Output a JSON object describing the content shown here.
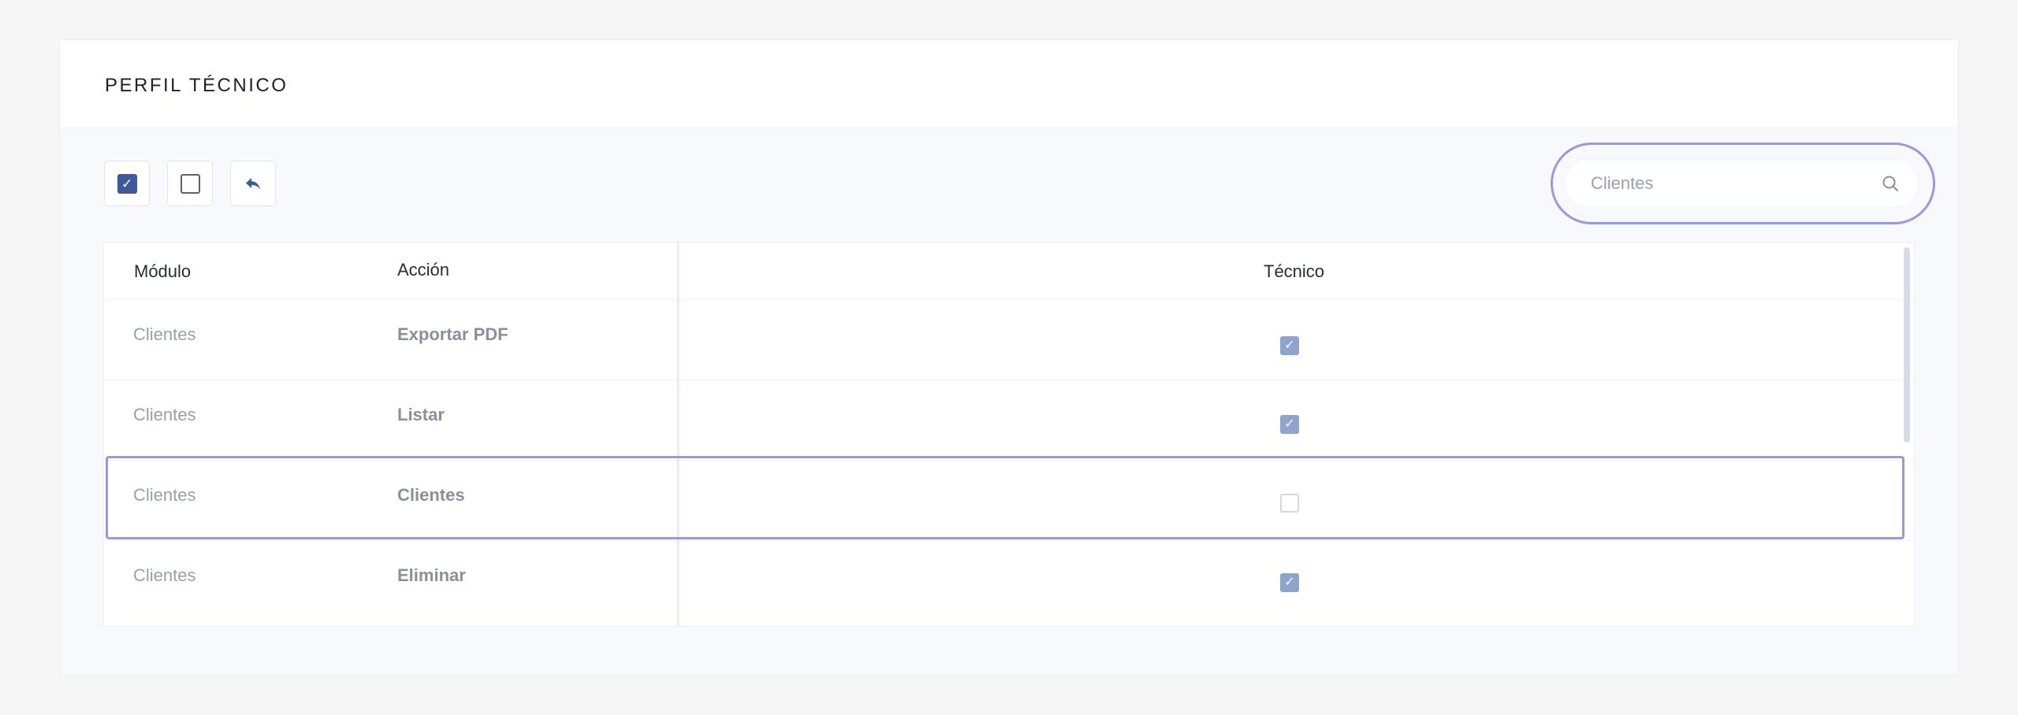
{
  "header": {
    "title": "PERFIL TÉCNICO"
  },
  "toolbar": {
    "check_all_icon": "check-square-icon",
    "uncheck_all_icon": "empty-square-icon",
    "undo_icon": "reply-arrow-icon",
    "check_glyph": "✓"
  },
  "search": {
    "placeholder": "Clientes",
    "icon": "search-icon"
  },
  "table": {
    "columns": {
      "modulo": "Módulo",
      "accion": "Acción",
      "tecnico": "Técnico"
    },
    "rows": [
      {
        "modulo": "Clientes",
        "accion": "Exportar PDF",
        "tecnico": true
      },
      {
        "modulo": "Clientes",
        "accion": "Listar",
        "tecnico": true
      },
      {
        "modulo": "Clientes",
        "accion": "Clientes",
        "tecnico": false
      },
      {
        "modulo": "Clientes",
        "accion": "Eliminar",
        "tecnico": true
      }
    ]
  },
  "colors": {
    "accent": "#3b5b9a",
    "highlight": "#9c98dc",
    "checked_cell": "#8fa3cf"
  }
}
